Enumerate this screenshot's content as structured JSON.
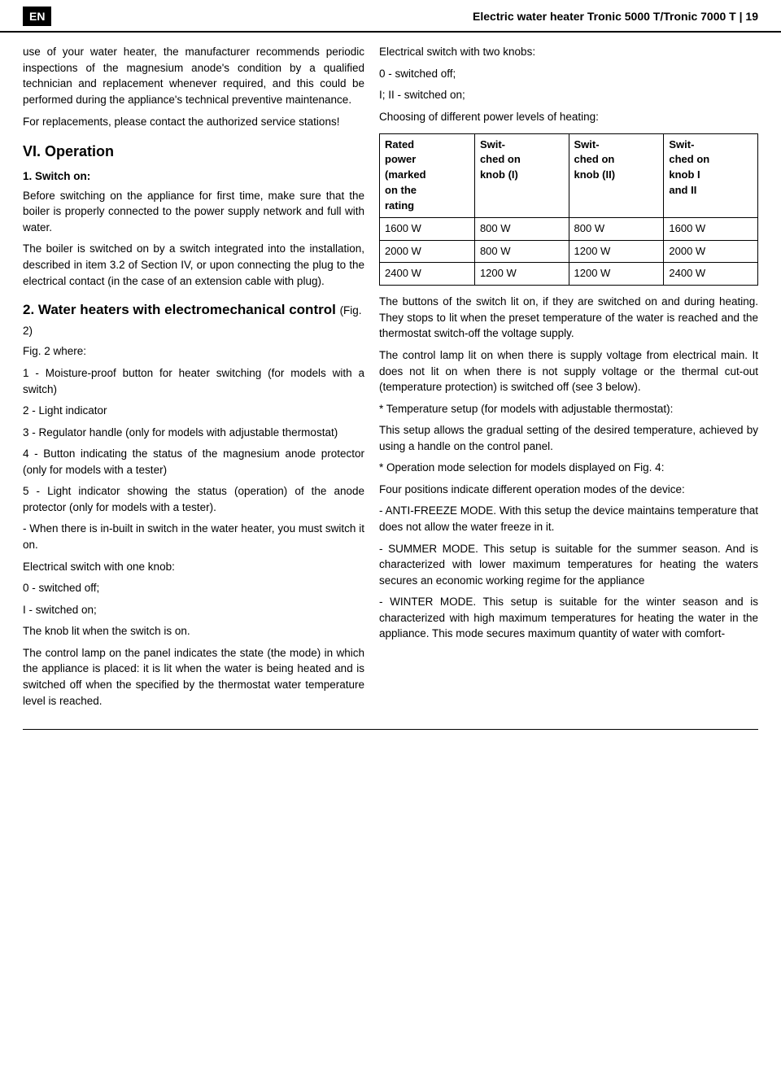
{
  "header": {
    "label_left": "EN",
    "title": "Electric water heater Tronic 5000 T/Tronic 7000 T  |  19"
  },
  "left_column": {
    "intro_paragraph": "use of your water heater, the manufacturer recommends periodic inspections of the magnesium anode's condition by a qualified technician and replacement whenever required, and this could be performed during the appliance's technical preventive maintenance.",
    "replacements_paragraph": "For replacements, please contact the authorized service stations!",
    "vi_operation": "VI. Operation",
    "switch_on_heading": "1. Switch on:",
    "switch_on_para1": "Before switching on the appliance for first time, make sure that the boiler is properly connected to the power supply network and full with water.",
    "switch_on_para2": "The boiler is switched on by a switch integrated into the installation, described in item 3.2 of Section IV, or upon connecting the plug to the electrical contact (in the case of an extension cable with plug).",
    "section2_heading": "2. Water heaters with electromechanical control",
    "section2_heading_fig": "(Fig. 2)",
    "fig2_where": "Fig. 2 where:",
    "items": [
      "1 - Moisture-proof button for heater switching (for models with a switch)",
      "2 - Light indicator",
      "3 - Regulator handle (only for models with adjustable thermostat)",
      "4 - Button indicating the status of the magnesium anode protector (only for models with a tester)",
      "5 - Light indicator showing the status (operation) of the anode protector (only for models with a tester)."
    ],
    "when_builtin": "- When there is in-built in switch in the water heater, you must switch it on.",
    "elec_one_knob": "Electrical switch with one knob:",
    "zero_off": "0 - switched off;",
    "i_on": "I - switched on;",
    "knob_lit": "The knob lit when the switch is on.",
    "control_lamp_para": "The control lamp on the panel indicates the state (the mode) in which the appliance is placed: it is lit when the water is being heated and is switched off when the specified by the thermostat water temperature level is reached."
  },
  "right_column": {
    "elec_two_knobs": "Electrical switch with two knobs:",
    "zero_off": "0 - switched off;",
    "i_ii_on": "I; II - switched on;",
    "choosing_intro": "Choosing of different power levels of heating:",
    "table": {
      "headers": [
        "Rated power (marked on the rating",
        "Switched on knob (I)",
        "Switched on knob (II)",
        "Switched on knob I and II"
      ],
      "rows": [
        [
          "1600 W",
          "800 W",
          "800 W",
          "1600 W"
        ],
        [
          "2000 W",
          "800 W",
          "1200 W",
          "2000 W"
        ],
        [
          "2400 W",
          "1200 W",
          "1200 W",
          "2400 W"
        ]
      ]
    },
    "buttons_para": "The buttons of the switch lit on, if they are switched on and during heating. They stops to lit when the preset temperature of the water is reached and the thermostat switch-off the voltage supply.",
    "control_lamp_para": "The control lamp lit on when there is supply voltage from electrical main. It does not lit on when there is not supply voltage or the thermal cut-out (temperature protection) is switched off (see 3 below).",
    "temp_setup_heading": "* Temperature setup (for models with adjustable thermostat):",
    "temp_setup_para": "This setup allows the gradual setting of the desired temperature, achieved by using a handle on the control panel.",
    "op_mode_heading": "* Operation mode selection for models displayed on Fig. 4:",
    "op_mode_para": "Four positions indicate different operation modes of the device:",
    "anti_freeze": " - ANTI-FREEZE MODE. With this setup the device maintains temperature that does not allow the water freeze in it.",
    "summer_mode": " - SUMMER MODE. This setup is suitable for the summer season. And is characterized with lower maximum temperatures for heating the waters secures an economic working regime for the appliance",
    "winter_mode": " - WINTER MODE. This setup is suitable for the winter season and is characterized with high maximum temperatures for heating the water in the appliance. This mode secures maximum quantity of water with comfort-"
  }
}
